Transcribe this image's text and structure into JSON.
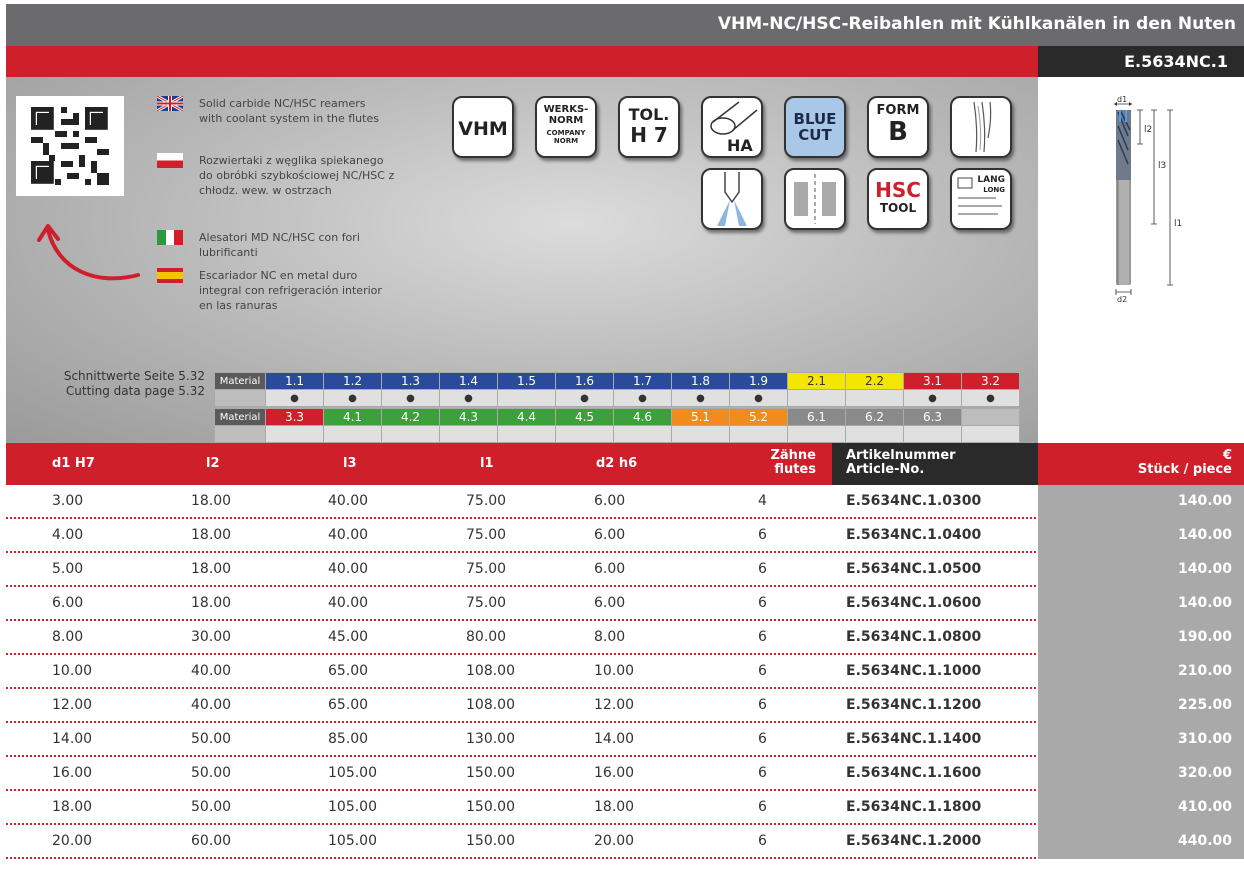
{
  "title": "VHM-NC/HSC-Reibahlen mit Kühlkanälen in den Nuten",
  "product_code": "E.5634NC.1",
  "languages": [
    {
      "flag": "uk-flag",
      "text": "Solid carbide NC/HSC reamers with coolant system in the flutes"
    },
    {
      "flag": "poland-flag",
      "text": "Rozwiertaki z węglika spiekanego do obróbki szybkościowej NC/HSC z chłodz. wew. w ostrzach"
    },
    {
      "flag": "italy-flag",
      "text": "Alesatori MD NC/HSC con fori lubrificanti"
    },
    {
      "flag": "spain-flag",
      "text": "Escariador NC en metal duro integral con refrigeración interior en las ranuras"
    }
  ],
  "icons": {
    "vhm": "VHM",
    "werksnorm_1": "WERKS-",
    "werksnorm_2": "NORM",
    "company_norm_1": "COMPANY",
    "company_norm_2": "NORM",
    "tol_1": "TOL.",
    "tol_2": "H 7",
    "ha": "HA",
    "blue_cut_1": "BLUE",
    "blue_cut_2": "CUT",
    "form_1": "FORM",
    "form_2": "B",
    "hsc_1": "HSC",
    "hsc_2": "TOOL",
    "lang_1": "LANG",
    "lang_2": "LONG"
  },
  "cutting_data": {
    "line1": "Schnittwerte Seite  5.32",
    "line2": "Cutting data page  5.32"
  },
  "materials_label": "Material",
  "materials_row1": [
    {
      "code": "1.1",
      "color": "#2a4a9a",
      "dot": "●"
    },
    {
      "code": "1.2",
      "color": "#2a4a9a",
      "dot": "●"
    },
    {
      "code": "1.3",
      "color": "#2a4a9a",
      "dot": "●"
    },
    {
      "code": "1.4",
      "color": "#2a4a9a",
      "dot": "●"
    },
    {
      "code": "1.5",
      "color": "#2a4a9a",
      "dot": ""
    },
    {
      "code": "1.6",
      "color": "#2a4a9a",
      "dot": "●"
    },
    {
      "code": "1.7",
      "color": "#2a4a9a",
      "dot": "●"
    },
    {
      "code": "1.8",
      "color": "#2a4a9a",
      "dot": "●"
    },
    {
      "code": "1.9",
      "color": "#2a4a9a",
      "dot": "●"
    },
    {
      "code": "2.1",
      "color": "#f3e600",
      "dot": ""
    },
    {
      "code": "2.2",
      "color": "#f3e600",
      "dot": ""
    },
    {
      "code": "3.1",
      "color": "#cf1f2b",
      "dot": "●"
    },
    {
      "code": "3.2",
      "color": "#cf1f2b",
      "dot": "●"
    }
  ],
  "materials_row2": [
    {
      "code": "3.3",
      "color": "#cf1f2b",
      "dot": ""
    },
    {
      "code": "4.1",
      "color": "#3ca03c",
      "dot": ""
    },
    {
      "code": "4.2",
      "color": "#3ca03c",
      "dot": ""
    },
    {
      "code": "4.3",
      "color": "#3ca03c",
      "dot": ""
    },
    {
      "code": "4.4",
      "color": "#3ca03c",
      "dot": ""
    },
    {
      "code": "4.5",
      "color": "#3ca03c",
      "dot": ""
    },
    {
      "code": "4.6",
      "color": "#3ca03c",
      "dot": ""
    },
    {
      "code": "5.1",
      "color": "#f08c1e",
      "dot": ""
    },
    {
      "code": "5.2",
      "color": "#f08c1e",
      "dot": ""
    },
    {
      "code": "6.1",
      "color": "#8a8a8a",
      "dot": ""
    },
    {
      "code": "6.2",
      "color": "#8a8a8a",
      "dot": ""
    },
    {
      "code": "6.3",
      "color": "#8a8a8a",
      "dot": ""
    },
    {
      "code": "",
      "color": "#bdbdbd",
      "dot": ""
    }
  ],
  "drawing_labels": {
    "d1": "d1",
    "l2": "l2",
    "l3": "l3",
    "l1": "l1",
    "d2": "d2"
  },
  "table_header": {
    "d1": "d1 H7",
    "l2": "l2",
    "l3": "l3",
    "l1": "l1",
    "d2": "d2 h6",
    "flutes_1": "Zähne",
    "flutes_2": "flutes",
    "article_1": "Artikelnummer",
    "article_2": "Article-No.",
    "price_1": "€",
    "price_2": "Stück / piece"
  },
  "rows": [
    {
      "d1": "3.00",
      "l2": "18.00",
      "l3": "40.00",
      "l1": "75.00",
      "d2": "6.00",
      "flutes": "4",
      "article": "E.5634NC.1.0300",
      "price": "140.00"
    },
    {
      "d1": "4.00",
      "l2": "18.00",
      "l3": "40.00",
      "l1": "75.00",
      "d2": "6.00",
      "flutes": "6",
      "article": "E.5634NC.1.0400",
      "price": "140.00"
    },
    {
      "d1": "5.00",
      "l2": "18.00",
      "l3": "40.00",
      "l1": "75.00",
      "d2": "6.00",
      "flutes": "6",
      "article": "E.5634NC.1.0500",
      "price": "140.00"
    },
    {
      "d1": "6.00",
      "l2": "18.00",
      "l3": "40.00",
      "l1": "75.00",
      "d2": "6.00",
      "flutes": "6",
      "article": "E.5634NC.1.0600",
      "price": "140.00"
    },
    {
      "d1": "8.00",
      "l2": "30.00",
      "l3": "45.00",
      "l1": "80.00",
      "d2": "8.00",
      "flutes": "6",
      "article": "E.5634NC.1.0800",
      "price": "190.00"
    },
    {
      "d1": "10.00",
      "l2": "40.00",
      "l3": "65.00",
      "l1": "108.00",
      "d2": "10.00",
      "flutes": "6",
      "article": "E.5634NC.1.1000",
      "price": "210.00"
    },
    {
      "d1": "12.00",
      "l2": "40.00",
      "l3": "65.00",
      "l1": "108.00",
      "d2": "12.00",
      "flutes": "6",
      "article": "E.5634NC.1.1200",
      "price": "225.00"
    },
    {
      "d1": "14.00",
      "l2": "50.00",
      "l3": "85.00",
      "l1": "130.00",
      "d2": "14.00",
      "flutes": "6",
      "article": "E.5634NC.1.1400",
      "price": "310.00"
    },
    {
      "d1": "16.00",
      "l2": "50.00",
      "l3": "105.00",
      "l1": "150.00",
      "d2": "16.00",
      "flutes": "6",
      "article": "E.5634NC.1.1600",
      "price": "320.00"
    },
    {
      "d1": "18.00",
      "l2": "50.00",
      "l3": "105.00",
      "l1": "150.00",
      "d2": "18.00",
      "flutes": "6",
      "article": "E.5634NC.1.1800",
      "price": "410.00"
    },
    {
      "d1": "20.00",
      "l2": "60.00",
      "l3": "105.00",
      "l1": "150.00",
      "d2": "20.00",
      "flutes": "6",
      "article": "E.5634NC.1.2000",
      "price": "440.00"
    }
  ]
}
